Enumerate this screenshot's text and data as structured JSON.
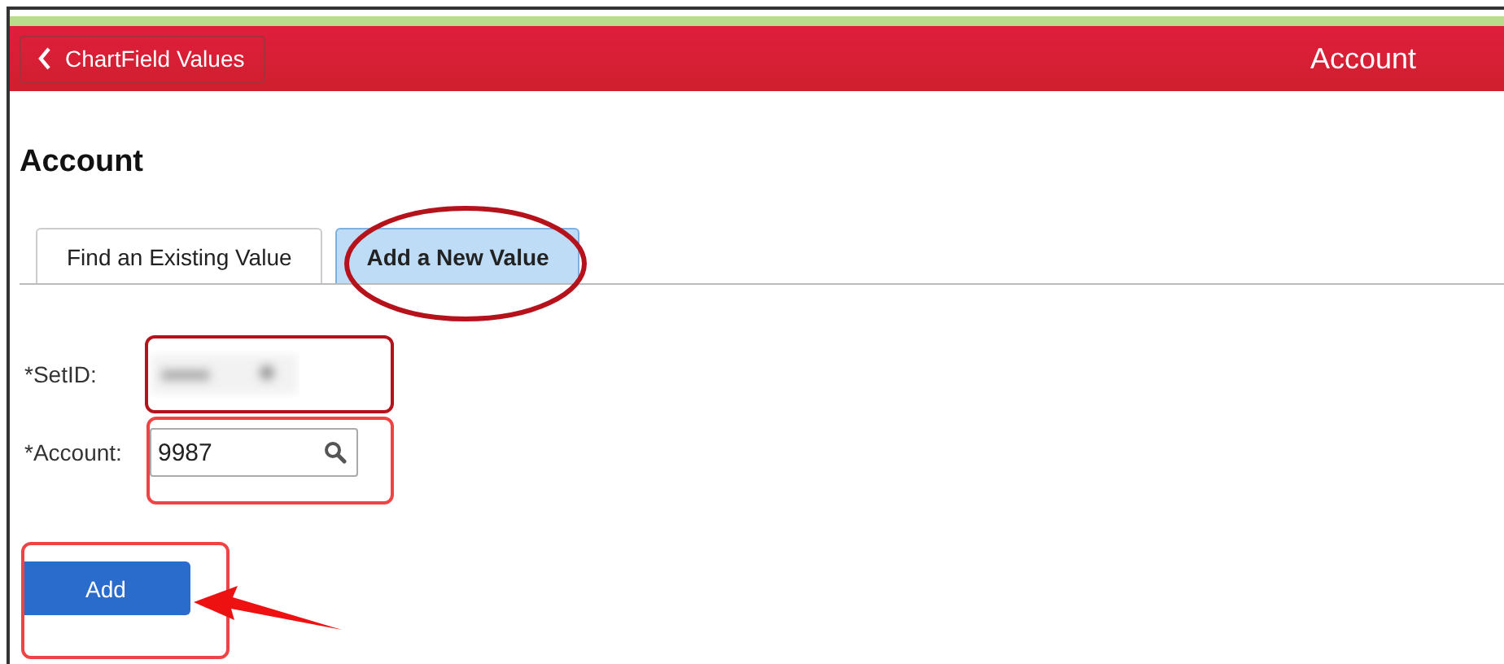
{
  "header": {
    "back_button": "ChartField Values",
    "title": "Account"
  },
  "page_title": "Account",
  "tabs": [
    {
      "label": "Find an Existing Value",
      "selected": false
    },
    {
      "label": "Add a New Value",
      "selected": true
    }
  ],
  "fields": [
    {
      "label": "*SetID:",
      "kind": "blurred"
    },
    {
      "label": "*Account:",
      "kind": "lookup",
      "value": "9987"
    }
  ],
  "button": "Add",
  "annotations": [
    {
      "kind": "ellipse"
    },
    {
      "kind": "box"
    },
    {
      "kind": "box"
    },
    {
      "kind": "box"
    },
    {
      "kind": "arrow"
    }
  ]
}
